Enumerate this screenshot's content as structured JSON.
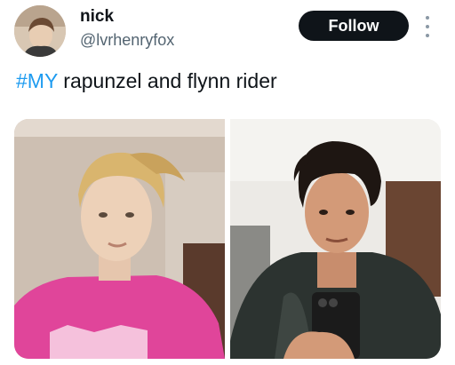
{
  "user": {
    "display_name": "nick",
    "handle": "@lvrhenryfox"
  },
  "follow_label": "Follow",
  "tweet": {
    "hashtag": "#MY",
    "text": " rapunzel and flynn rider"
  },
  "colors": {
    "hashtag": "#1d9bf0",
    "follow_button_bg": "#0f1419",
    "handle_text": "#536471"
  },
  "icons": {
    "more": "more-vertical-icon"
  }
}
